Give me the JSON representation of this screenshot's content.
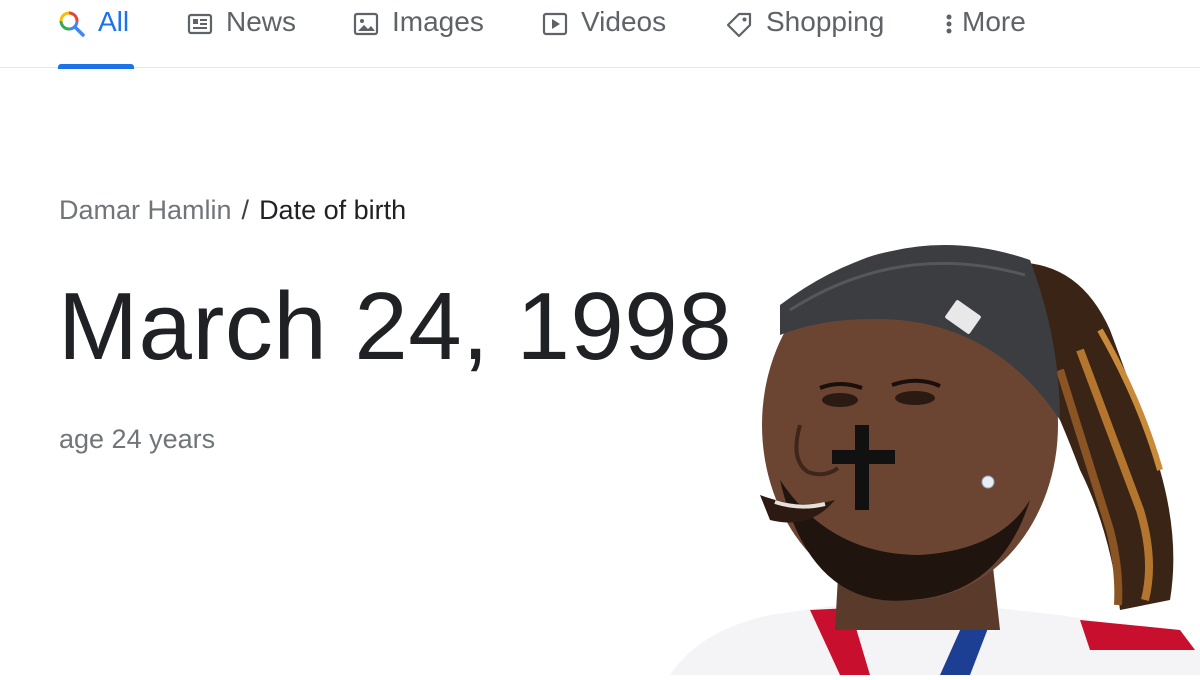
{
  "tabs": {
    "all": "All",
    "news": "News",
    "images": "Images",
    "videos": "Videos",
    "shopping": "Shopping",
    "more": "More",
    "active": "all"
  },
  "breadcrumb": {
    "entity": "Damar Hamlin",
    "separator": "/",
    "attribute": "Date of birth"
  },
  "answer": {
    "value": "March 24, 1998",
    "subtext": "age 24 years"
  },
  "photo": {
    "subject": "portrait-of-football-player"
  },
  "colors": {
    "accent": "#1a73e8",
    "muted": "#70757a",
    "text": "#202124"
  }
}
